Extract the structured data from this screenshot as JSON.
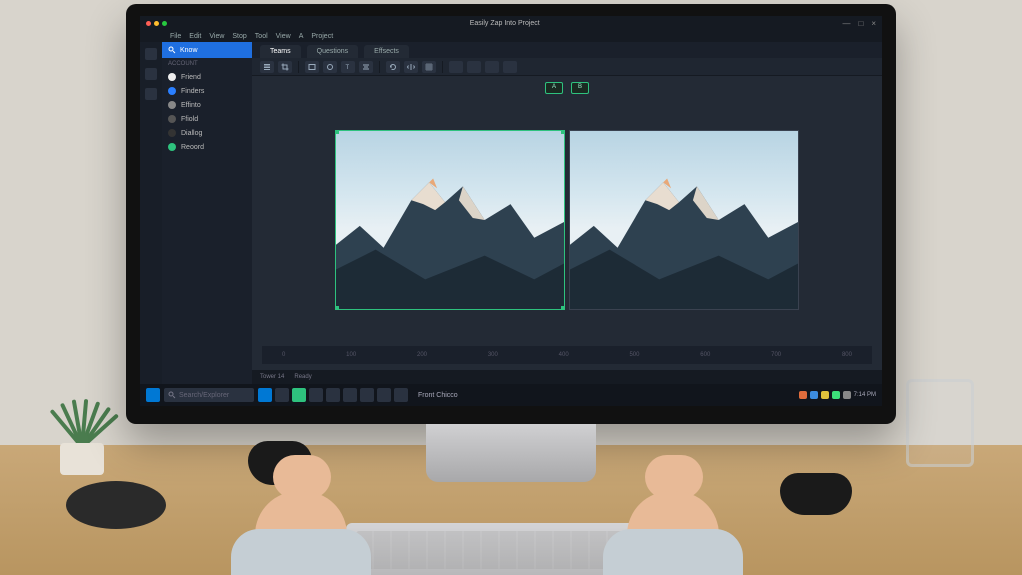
{
  "titlebar": {
    "app_title": "Easily Zap Into Project"
  },
  "menu": {
    "items": [
      "File",
      "Edit",
      "View",
      "Stop",
      "Tool",
      "View",
      "A",
      "Project"
    ]
  },
  "window_controls": {
    "min": "—",
    "max": "□",
    "close": "×"
  },
  "rail": {
    "tools": [
      "move",
      "select",
      "search"
    ]
  },
  "sidebar": {
    "search_label": "Know",
    "section_a": "Account",
    "items": [
      {
        "label": "Friend",
        "dot": "d1"
      },
      {
        "label": "Finders",
        "dot": "d2"
      },
      {
        "label": "Effinto",
        "dot": "d3"
      },
      {
        "label": "Ffiold",
        "dot": "d4"
      },
      {
        "label": "Diallog",
        "dot": "d5"
      },
      {
        "label": "Reoord",
        "dot": "d6"
      }
    ]
  },
  "tabs": [
    {
      "label": "Teams",
      "active": true
    },
    {
      "label": "Questions",
      "active": false
    },
    {
      "label": "Effsects",
      "active": false
    }
  ],
  "toolbar": {
    "buttons": [
      "layers",
      "crop",
      "rect",
      "circle",
      "text",
      "align",
      "rotate",
      "flip",
      "grid",
      "mask",
      "fill",
      "fx",
      "dup"
    ]
  },
  "canvas": {
    "label_a": "A",
    "label_b": "B",
    "img_alt": "Snowy mountain range at sunrise"
  },
  "ruler": {
    "marks": [
      "0",
      "100",
      "200",
      "300",
      "400",
      "500",
      "600",
      "700",
      "800"
    ]
  },
  "status": {
    "zoom": "Tower 14",
    "info": "Ready"
  },
  "taskbar": {
    "search_placeholder": "Search/Explorer",
    "app_count": 9,
    "tray_label": "Front Chicco",
    "time": "7:14 PM"
  }
}
